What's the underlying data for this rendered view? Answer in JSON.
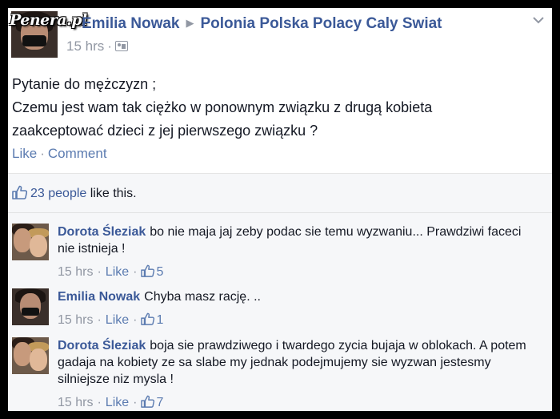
{
  "post": {
    "watermark": "Penera.pl",
    "author": "Emilia Nowak",
    "group": "Polonia Polska Polacy Caly Swiat",
    "time": "15 hrs",
    "meta_separator": "·",
    "text_lines": [
      "Pytanie do mężczyzn ;",
      "Czemu jest wam tak ciężko w ponownym związku z drugą kobieta",
      "zaakceptować dzieci z jej pierwszego związku ?"
    ],
    "actions": {
      "like": "Like",
      "separator": "·",
      "comment": "Comment"
    }
  },
  "likes": {
    "people": "23 people",
    "suffix": " like this."
  },
  "comments": [
    {
      "author": "Dorota Śleziak",
      "text": "bo nie maja jaj zeby podac sie temu wyzwaniu... Prawdziwi faceci nie istnieja !",
      "time": "15 hrs",
      "like_label": "Like",
      "like_count": "5"
    },
    {
      "author": "Emilia Nowak",
      "text": "Chyba masz rację. ..",
      "time": "15 hrs",
      "like_label": "Like",
      "like_count": "1"
    },
    {
      "author": "Dorota Śleziak",
      "text": "boja sie prawdziwego i twardego zycia bujaja w oblokach. A potem gadaja na kobiety ze sa slabe my jednak podejmujemy sie wyzwan jestesmy silniejsze niz mysla !",
      "time": "15 hrs",
      "like_label": "Like",
      "like_count": "7"
    }
  ],
  "colors": {
    "link": "#3b5998",
    "muted": "#9197a3",
    "action_link": "#5b7bb0",
    "text": "#141823",
    "feedback_bg": "#f6f7f9"
  },
  "icons": {
    "audience": "group-audience-icon",
    "thumbs_up": "thumbs-up-icon",
    "options": "chevron-down-icon"
  }
}
